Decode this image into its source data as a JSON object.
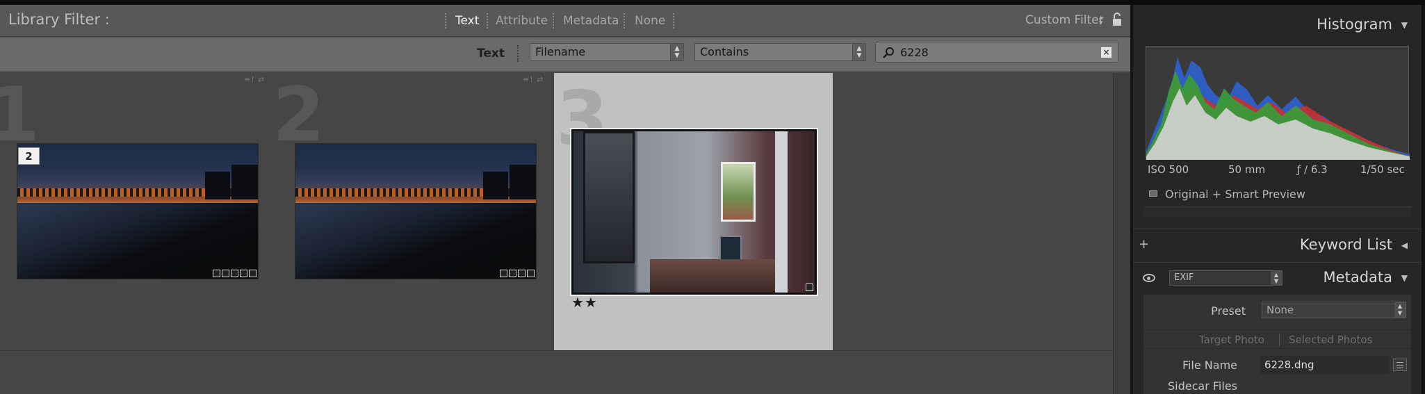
{
  "filter_bar": {
    "title": "Library Filter :",
    "tabs": [
      {
        "label": "Text",
        "active": true
      },
      {
        "label": "Attribute",
        "active": false
      },
      {
        "label": "Metadata",
        "active": false
      },
      {
        "label": "None",
        "active": false
      }
    ],
    "custom_filter_label": "Custom Filter",
    "lock_icon": "lock-icon"
  },
  "text_filter": {
    "label": "Text",
    "field_select": "Filename",
    "rule_select": "Contains",
    "search_value": "6228",
    "search_icon": "search-icon",
    "clear_icon": "clear-icon"
  },
  "grid": {
    "cells": [
      {
        "index": "1",
        "stack_count": "2",
        "rating": ""
      },
      {
        "index": "2",
        "stack_count": "",
        "rating": ""
      },
      {
        "index": "3",
        "stack_count": "",
        "rating": "★★",
        "selected": true
      }
    ]
  },
  "right_panel": {
    "histogram": {
      "title": "Histogram",
      "iso": "ISO 500",
      "focal_length": "50 mm",
      "aperture": "ƒ / 6.3",
      "shutter": "1/50 sec",
      "preview_status": "Original + Smart Preview"
    },
    "keyword_list": {
      "title": "Keyword List"
    },
    "metadata": {
      "title": "Metadata",
      "view_select": "EXIF",
      "preset_label": "Preset",
      "preset_value": "None",
      "target_photo": "Target Photo",
      "selected_photos": "Selected Photos",
      "file_name_label": "File Name",
      "file_name_value": "6228.dng",
      "sidecar_label": "Sidecar Files"
    }
  },
  "colors": {
    "panel_bg": "#262626",
    "grid_bg": "#464646",
    "selected_cell_bg": "#c1c1c1"
  }
}
